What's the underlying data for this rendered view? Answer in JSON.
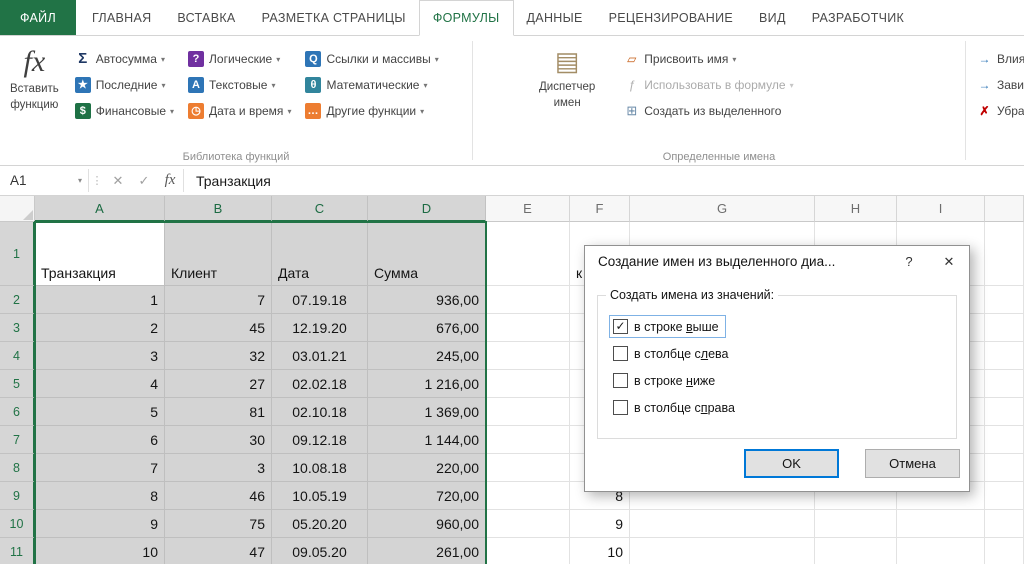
{
  "colors": {
    "accent_green": "#217346",
    "selection_fill": "#d4d4d4",
    "default_button_border": "#0078d7",
    "disabled_text": "#ababab"
  },
  "icons": {
    "caret": "▾",
    "check": "✓",
    "cancel": "✕",
    "close": "✕",
    "help": "?",
    "fx": "fx",
    "dots": "⋮",
    "name_manager": "▤",
    "tag": "▱",
    "use_in_formula": "ƒ",
    "create_from_selection": "⊞",
    "trace_precedents": "→",
    "trace_dependents": "→",
    "remove_arrows": "✗"
  },
  "ribbon": {
    "tabs": [
      {
        "label": "ФАЙЛ"
      },
      {
        "label": "ГЛАВНАЯ"
      },
      {
        "label": "ВСТАВКА"
      },
      {
        "label": "РАЗМЕТКА СТРАНИЦЫ"
      },
      {
        "label": "ФОРМУЛЫ"
      },
      {
        "label": "ДАННЫЕ"
      },
      {
        "label": "РЕЦЕНЗИРОВАНИЕ"
      },
      {
        "label": "ВИД"
      },
      {
        "label": "РАЗРАБОТЧИК"
      }
    ],
    "active_tab": "ФОРМУЛЫ",
    "insert_function": {
      "icon": "fx",
      "line1": "Вставить",
      "line2": "функцию"
    },
    "function_library": {
      "label": "Библиотека функций",
      "buttons": [
        {
          "label": "Автосумма",
          "icon": "Σ"
        },
        {
          "label": "Последние",
          "icon": "★"
        },
        {
          "label": "Финансовые",
          "icon": "$"
        },
        {
          "label": "Логические",
          "icon": "?"
        },
        {
          "label": "Текстовые",
          "icon": "А"
        },
        {
          "label": "Дата и время",
          "icon": "◷"
        },
        {
          "label": "Ссылки и массивы",
          "icon": "Q"
        },
        {
          "label": "Математические",
          "icon": "θ"
        },
        {
          "label": "Другие функции",
          "icon": "…"
        }
      ]
    },
    "defined_names": {
      "label": "Определенные имена",
      "name_manager": {
        "line1": "Диспетчер",
        "line2": "имен"
      },
      "items": [
        {
          "label": "Присвоить имя",
          "caret": true,
          "disabled": false
        },
        {
          "label": "Использовать в формуле",
          "caret": true,
          "disabled": true
        },
        {
          "label": "Создать из выделенного",
          "caret": false,
          "disabled": false
        }
      ]
    },
    "formula_auditing": {
      "items": [
        {
          "label": "Влияющие ячейки"
        },
        {
          "label": "Зависимые ячейки"
        },
        {
          "label": "Убрать стрелки"
        }
      ]
    }
  },
  "formula_bar": {
    "name_box": "A1",
    "content": "Транзакция"
  },
  "sheet": {
    "columns": [
      "A",
      "B",
      "C",
      "D",
      "E",
      "F",
      "G",
      "H",
      "I"
    ],
    "selection": {
      "range": "A1:D11",
      "active_cell": "A1",
      "columns": [
        "A",
        "B",
        "C",
        "D"
      ]
    },
    "rows": [
      {
        "n": "1",
        "A": "Транзакция",
        "B": "Клиент",
        "C": "Дата",
        "D": "Сумма",
        "F": "к"
      },
      {
        "n": "2",
        "A": "1",
        "B": "7",
        "C": "07.19.18",
        "D": "936,00"
      },
      {
        "n": "3",
        "A": "2",
        "B": "45",
        "C": "12.19.20",
        "D": "676,00"
      },
      {
        "n": "4",
        "A": "3",
        "B": "32",
        "C": "03.01.21",
        "D": "245,00"
      },
      {
        "n": "5",
        "A": "4",
        "B": "27",
        "C": "02.02.18",
        "D": "1 216,00"
      },
      {
        "n": "6",
        "A": "5",
        "B": "81",
        "C": "02.10.18",
        "D": "1 369,00"
      },
      {
        "n": "7",
        "A": "6",
        "B": "30",
        "C": "09.12.18",
        "D": "1 144,00"
      },
      {
        "n": "8",
        "A": "7",
        "B": "3",
        "C": "10.08.18",
        "D": "220,00"
      },
      {
        "n": "9",
        "A": "8",
        "B": "46",
        "C": "10.05.19",
        "D": "720,00",
        "F": "8"
      },
      {
        "n": "10",
        "A": "9",
        "B": "75",
        "C": "05.20.20",
        "D": "960,00",
        "F": "9"
      },
      {
        "n": "11",
        "A": "10",
        "B": "47",
        "C": "09.05.20",
        "D": "261,00",
        "F": "10"
      }
    ]
  },
  "dialog": {
    "title": "Создание имен из выделенного диа...",
    "group_label": "Создать имена из значений:",
    "checkboxes": [
      {
        "prefix": "в строке ",
        "accel": "в",
        "suffix": "ыше",
        "checked": true,
        "focused": true
      },
      {
        "prefix": "в столбце с",
        "accel": "л",
        "suffix": "ева",
        "checked": false
      },
      {
        "prefix": "в строке ",
        "accel": "н",
        "suffix": "иже",
        "checked": false
      },
      {
        "prefix": "в столбце с",
        "accel": "п",
        "suffix": "рава",
        "checked": false
      }
    ],
    "ok": "OK",
    "cancel": "Отмена"
  }
}
